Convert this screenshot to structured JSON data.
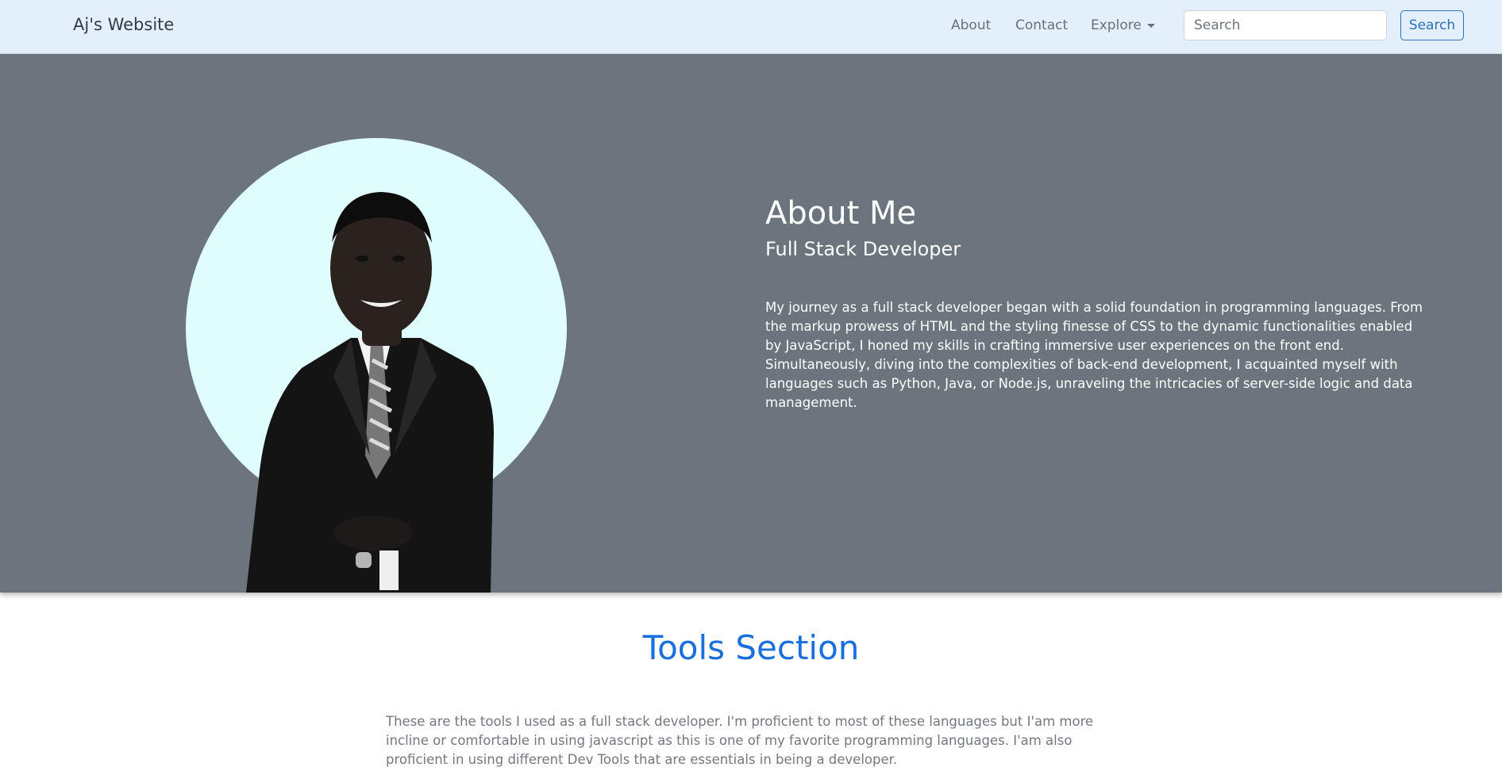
{
  "navbar": {
    "brand": "Aj's Website",
    "links": [
      "About",
      "Contact"
    ],
    "dropdown_label": "Explore",
    "search_placeholder": "Search",
    "search_button": "Search"
  },
  "hero": {
    "title": "About Me",
    "subtitle": "Full Stack Developer",
    "paragraph": "My journey as a full stack developer began with a solid foundation in programming languages. From the markup prowess of HTML and the styling finesse of CSS to the dynamic functionalities enabled by JavaScript, I honed my skills in crafting immersive user experiences on the front end. Simultaneously, diving into the complexities of back-end development, I acquainted myself with languages such as Python, Java, or Node.js, unraveling the intricacies of server-side logic and data management."
  },
  "tools": {
    "title": "Tools Section",
    "paragraph": "These are the tools I used as a full stack developer. I'm proficient to most of these languages but I'am more incline or comfortable in using javascript as this is one of my favorite programming languages. I'am also proficient in using different Dev Tools that are essentials in being a developer."
  },
  "colors": {
    "navbar_bg": "#e3f0fc",
    "hero_bg": "#6c757d",
    "portrait_circle": "#e0fdfd",
    "accent_blue": "#1a6fe0"
  }
}
